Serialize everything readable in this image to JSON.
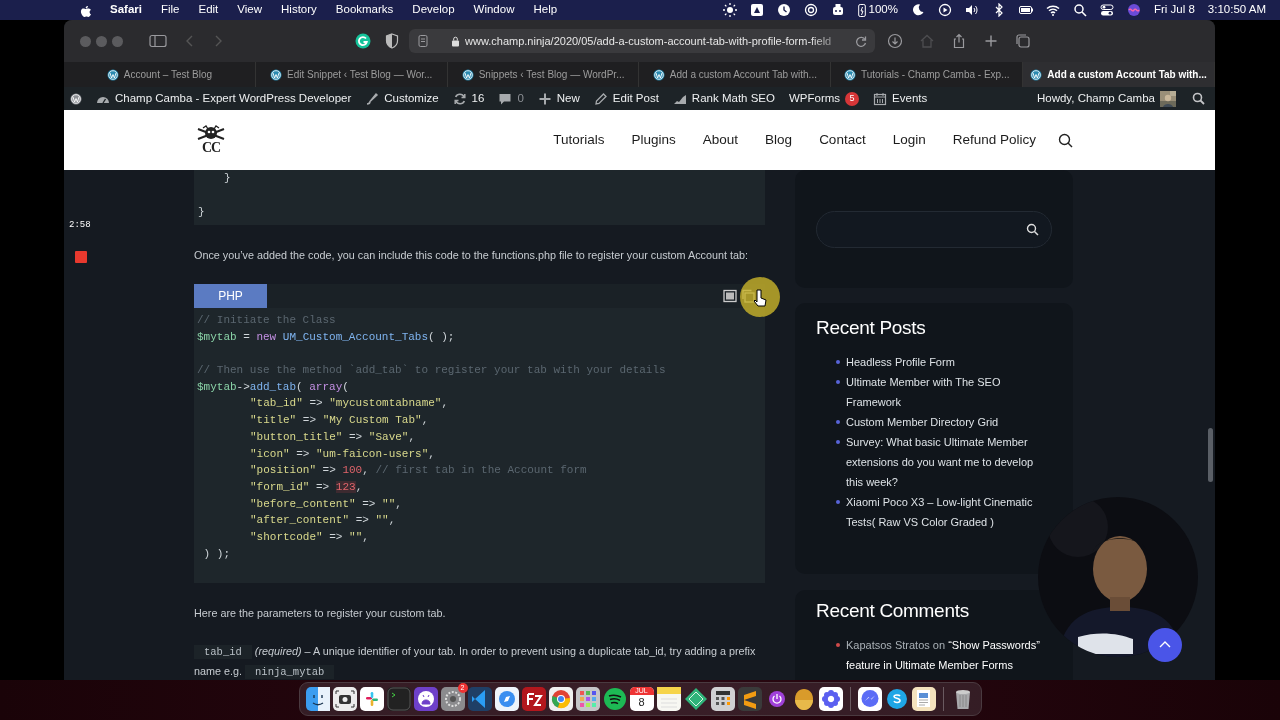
{
  "menu_bar": {
    "app": "Safari",
    "menus": [
      "File",
      "Edit",
      "View",
      "History",
      "Bookmarks",
      "Develop",
      "Window",
      "Help"
    ],
    "battery": "100%",
    "date": "Fri Jul 8",
    "time": "3:10:50 AM"
  },
  "recorder": {
    "timer": "2:58"
  },
  "browser": {
    "url": "www.champ.ninja/2020/05/add-a-custom-account-tab-with-profile-form-field",
    "tabs": [
      {
        "title": "Account – Test Blog",
        "selected": false
      },
      {
        "title": "Edit Snippet ‹ Test Blog — Wor...",
        "selected": false
      },
      {
        "title": "Snippets ‹ Test Blog — WordPr...",
        "selected": false
      },
      {
        "title": "Add a custom Account Tab with...",
        "selected": false
      },
      {
        "title": "Tutorials - Champ Camba - Exp...",
        "selected": false
      },
      {
        "title": "Add a custom Account Tab with...",
        "selected": true
      }
    ]
  },
  "admin_bar": {
    "site": "Champ Camba - Expert WordPress Developer",
    "items": [
      {
        "kind": "customize",
        "label": "Customize"
      },
      {
        "kind": "updates",
        "label": "16"
      },
      {
        "kind": "comments",
        "label": "0"
      },
      {
        "kind": "new",
        "label": "New"
      },
      {
        "kind": "edit",
        "label": "Edit Post"
      },
      {
        "kind": "seo",
        "label": "Rank Math SEO"
      },
      {
        "kind": "forms",
        "label": "WPForms",
        "badge": "5"
      },
      {
        "kind": "events",
        "label": "Events"
      }
    ],
    "greeting": "Howdy, Champ Camba"
  },
  "site": {
    "logo_text": "CC",
    "nav": [
      "Tutorials",
      "Plugins",
      "About",
      "Blog",
      "Contact",
      "Login",
      "Refund Policy"
    ]
  },
  "article": {
    "prev_code": [
      {
        "indent": true,
        "text": "}"
      },
      {
        "gap_before": true,
        "text": "}"
      }
    ],
    "intro": "Once you’ve added the code, you can include this code to the functions.php file to register your custom Account tab:",
    "code_block": {
      "language": "PHP",
      "lines": [
        {
          "tokens": [
            {
              "kind": "comment",
              "text": "// Initiate the Class"
            }
          ]
        },
        {
          "tokens": [
            {
              "kind": "var",
              "text": "$mytab"
            },
            {
              "kind": "plain",
              "text": " = "
            },
            {
              "kind": "keyword",
              "text": "new"
            },
            {
              "kind": "class",
              "text": " UM_Custom_Account_Tabs"
            },
            {
              "kind": "plain",
              "text": "( );"
            }
          ]
        },
        {
          "gap_before": true,
          "tokens": [
            {
              "kind": "comment",
              "text": "// Then use the method `add_tab` to register your tab with your details"
            }
          ]
        },
        {
          "tokens": [
            {
              "kind": "var",
              "text": "$mytab"
            },
            {
              "kind": "plain",
              "text": "->"
            },
            {
              "kind": "func",
              "text": "add_tab"
            },
            {
              "kind": "plain",
              "text": "( "
            },
            {
              "kind": "keyword",
              "text": "array"
            },
            {
              "kind": "plain",
              "text": "("
            }
          ]
        },
        {
          "indent": true,
          "tokens": [
            {
              "kind": "string",
              "text": "\"tab_id\""
            },
            {
              "kind": "plain",
              "text": " => "
            },
            {
              "kind": "string",
              "text": "\"mycustomtabname\""
            },
            {
              "kind": "plain",
              "text": ","
            }
          ]
        },
        {
          "indent": true,
          "tokens": [
            {
              "kind": "string",
              "text": "\"title\""
            },
            {
              "kind": "plain",
              "text": " => "
            },
            {
              "kind": "string",
              "text": "\"My Custom Tab\""
            },
            {
              "kind": "plain",
              "text": ","
            }
          ]
        },
        {
          "indent": true,
          "tokens": [
            {
              "kind": "string",
              "text": "\"button_title\""
            },
            {
              "kind": "plain",
              "text": " => "
            },
            {
              "kind": "string",
              "text": "\"Save\""
            },
            {
              "kind": "plain",
              "text": ","
            }
          ]
        },
        {
          "indent": true,
          "tokens": [
            {
              "kind": "string",
              "text": "\"icon\""
            },
            {
              "kind": "plain",
              "text": " => "
            },
            {
              "kind": "string",
              "text": "\"um-faicon-users\""
            },
            {
              "kind": "plain",
              "text": ","
            }
          ]
        },
        {
          "indent": true,
          "tokens": [
            {
              "kind": "string",
              "text": "\"position\""
            },
            {
              "kind": "plain",
              "text": " => "
            },
            {
              "kind": "number",
              "text": "100"
            },
            {
              "kind": "plain",
              "text": ", "
            },
            {
              "kind": "comment",
              "text": "// first tab in the Account form"
            }
          ]
        },
        {
          "indent": true,
          "tokens": [
            {
              "kind": "string",
              "text": "\"form_id\""
            },
            {
              "kind": "plain",
              "text": " => "
            },
            {
              "kind": "mark",
              "text": "123"
            },
            {
              "kind": "plain",
              "text": ","
            }
          ]
        },
        {
          "indent": true,
          "tokens": [
            {
              "kind": "string",
              "text": "\"before_content\""
            },
            {
              "kind": "plain",
              "text": " => "
            },
            {
              "kind": "string",
              "text": "\"\""
            },
            {
              "kind": "plain",
              "text": ","
            }
          ]
        },
        {
          "indent": true,
          "tokens": [
            {
              "kind": "string",
              "text": "\"after_content\""
            },
            {
              "kind": "plain",
              "text": " => "
            },
            {
              "kind": "string",
              "text": "\"\""
            },
            {
              "kind": "plain",
              "text": ","
            }
          ]
        },
        {
          "indent": true,
          "tokens": [
            {
              "kind": "string",
              "text": "\"shortcode\""
            },
            {
              "kind": "plain",
              "text": " => "
            },
            {
              "kind": "string",
              "text": "\"\""
            },
            {
              "kind": "plain",
              "text": ","
            }
          ]
        },
        {
          "tokens": [
            {
              "kind": "plain",
              "text": " ) );"
            }
          ]
        }
      ]
    },
    "params_intro": "Here are the parameters to register your custom tab.",
    "param": {
      "code": "tab_id",
      "description": "*(required)* – A unique identifier of your tab. In order to prevent using a duplicate tab_id, try adding a prefix name e.g.",
      "example": "ninja_mytab"
    }
  },
  "sidebar": {
    "recent_posts": {
      "title": "Recent Posts",
      "items": [
        "Headless Profile Form",
        "Ultimate Member with The SEO Framework",
        "Custom Member Directory Grid",
        "Survey: What basic Ultimate Member extensions do you want me to develop this week?",
        "Xiaomi Poco X3 – Low-light Cinematic Tests( Raw VS Color Graded )"
      ]
    },
    "recent_comments": {
      "title": "Recent Comments",
      "items": [
        {
          "author": "Kapatsos Stratos",
          "joiner": "on",
          "post": "“Show Passwords” feature in Ultimate Member Forms"
        }
      ]
    }
  },
  "dock": {
    "groups": [
      [
        {
          "kind": "finder"
        },
        {
          "kind": "capture"
        },
        {
          "kind": "slack"
        },
        {
          "kind": "terminal"
        },
        {
          "kind": "github"
        },
        {
          "kind": "settings",
          "badge": "2"
        },
        {
          "kind": "vscode"
        },
        {
          "kind": "safari"
        },
        {
          "kind": "filezilla"
        },
        {
          "kind": "chrome"
        },
        {
          "kind": "launchpad"
        },
        {
          "kind": "spotify"
        },
        {
          "kind": "calendar",
          "month": "JUL",
          "day": "8"
        },
        {
          "kind": "notes"
        },
        {
          "kind": "gem"
        },
        {
          "kind": "calculator"
        },
        {
          "kind": "sublime"
        },
        {
          "kind": "power"
        },
        {
          "kind": "mascot"
        },
        {
          "kind": "flower"
        }
      ],
      [
        {
          "kind": "messenger"
        },
        {
          "kind": "skype"
        },
        {
          "kind": "pages"
        }
      ],
      [
        {
          "kind": "trash"
        }
      ]
    ]
  }
}
